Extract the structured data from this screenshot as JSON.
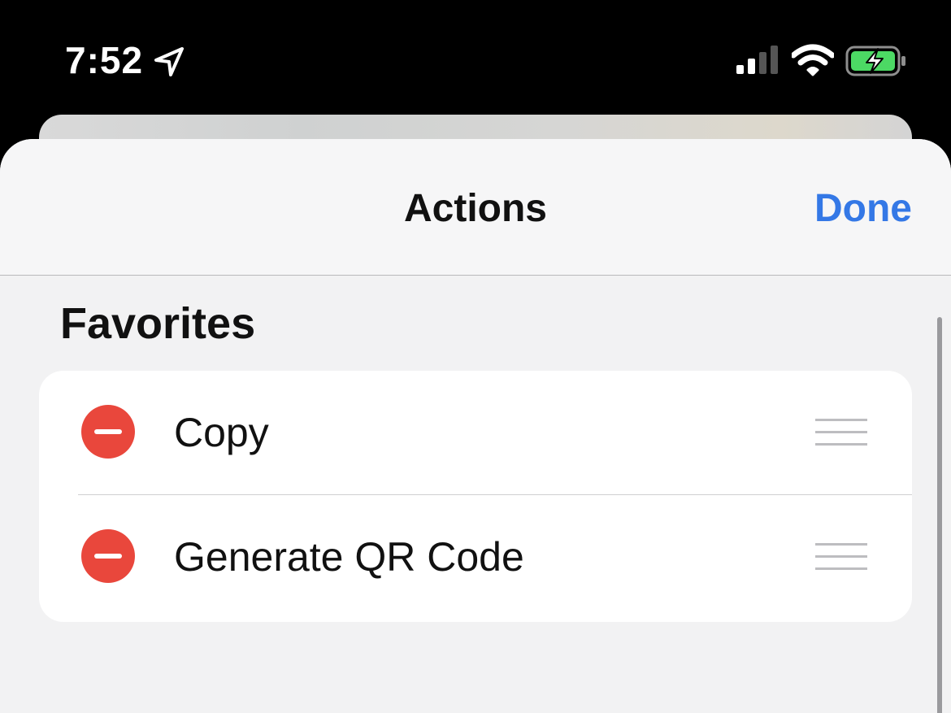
{
  "status_bar": {
    "time": "7:52",
    "icons": [
      "location-arrow-icon",
      "cellular-signal-icon",
      "wifi-icon",
      "battery-charging-icon"
    ],
    "battery_color": "#4cd964"
  },
  "sheet": {
    "title": "Actions",
    "done_label": "Done",
    "accent_color": "#3478e6"
  },
  "favorites": {
    "section_title": "Favorites",
    "items": [
      {
        "label": "Copy"
      },
      {
        "label": "Generate QR Code"
      }
    ],
    "remove_color": "#e9473c"
  }
}
